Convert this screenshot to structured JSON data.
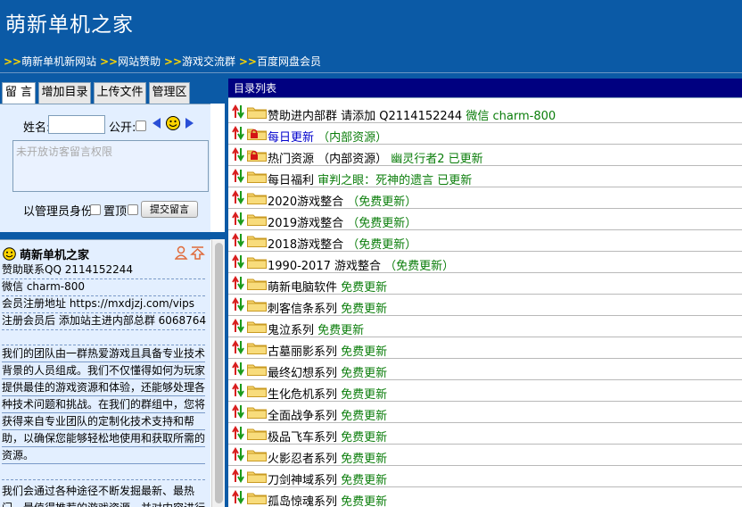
{
  "header": {
    "title": "萌新单机之家",
    "nav": [
      {
        "arrow": ">>",
        "label": "萌新单机新网站"
      },
      {
        "arrow": ">>",
        "label": "网站赞助"
      },
      {
        "arrow": ">>",
        "label": "游戏交流群"
      },
      {
        "arrow": ">>",
        "label": "百度网盘会员"
      }
    ]
  },
  "tabs": [
    "留 言",
    "增加目录",
    "上传文件",
    "管理区"
  ],
  "message_form": {
    "name_label": "姓名:",
    "name_value": "",
    "public_label": "公开:",
    "message_placeholder": "未开放访客留言权限",
    "admin_label": "以管理员身份",
    "pin_label": "置顶",
    "submit_label": "提交留言"
  },
  "info": {
    "title": "萌新单机之家",
    "lines": [
      "赞助联系QQ 2114152244",
      "微信 charm-800",
      "会员注册地址 https://mxdjzj.com/vips",
      "注册会员后 添加站主进内部总群 6068764"
    ],
    "para1": "我们的团队由一群热爱游戏且具备专业技术背景的人员组成。我们不仅懂得如何为玩家提供最佳的游戏资源和体验，还能够处理各种技术问题和挑战。在我们的群组中，您将获得来自专业团队的定制化技术支持和帮助，以确保您能够轻松地使用和获取所需的资源。",
    "para2": "我们会通过各种途径不断发掘最新、最热门、最值得推荐的游戏资源，并对内容进行"
  },
  "list": {
    "header": "目录列表",
    "rows": [
      {
        "name": "赞助进内部群 请添加 Q2114152244",
        "note": "微信 charm-800",
        "locked": false,
        "blue": false
      },
      {
        "name": "每日更新",
        "note": "（内部资源）",
        "locked": true,
        "blue": true
      },
      {
        "name": "热门资源 （内部资源）",
        "note": "幽灵行者2 已更新",
        "locked": true,
        "blue": false
      },
      {
        "name": "每日福利",
        "note": "审判之眼：死神的遗言 已更新",
        "locked": false,
        "blue": false
      },
      {
        "name": "2020游戏整合",
        "note": "（免费更新）",
        "locked": false,
        "blue": false
      },
      {
        "name": "2019游戏整合",
        "note": "（免费更新）",
        "locked": false,
        "blue": false
      },
      {
        "name": "2018游戏整合",
        "note": "（免费更新）",
        "locked": false,
        "blue": false
      },
      {
        "name": "1990-2017 游戏整合",
        "note": "（免费更新）",
        "locked": false,
        "blue": false
      },
      {
        "name": "萌新电脑软件",
        "note": "免费更新",
        "locked": false,
        "blue": false
      },
      {
        "name": "刺客信条系列",
        "note": "免费更新",
        "locked": false,
        "blue": false
      },
      {
        "name": "鬼泣系列",
        "note": "免费更新",
        "locked": false,
        "blue": false
      },
      {
        "name": "古墓丽影系列",
        "note": "免费更新",
        "locked": false,
        "blue": false
      },
      {
        "name": "最终幻想系列",
        "note": "免费更新",
        "locked": false,
        "blue": false
      },
      {
        "name": "生化危机系列",
        "note": "免费更新",
        "locked": false,
        "blue": false
      },
      {
        "name": "全面战争系列",
        "note": "免费更新",
        "locked": false,
        "blue": false
      },
      {
        "name": "极品飞车系列",
        "note": "免费更新",
        "locked": false,
        "blue": false
      },
      {
        "name": "火影忍者系列",
        "note": "免费更新",
        "locked": false,
        "blue": false
      },
      {
        "name": "刀剑神域系列",
        "note": "免费更新",
        "locked": false,
        "blue": false
      },
      {
        "name": "孤岛惊魂系列",
        "note": "免费更新",
        "locked": false,
        "blue": false
      }
    ]
  },
  "colors": {
    "header_bg": "#0b5aa6",
    "list_header_bg": "#000080",
    "note_green": "#0a7d0a",
    "link_blue": "#0000cc",
    "panel_bg": "#e3efff"
  }
}
